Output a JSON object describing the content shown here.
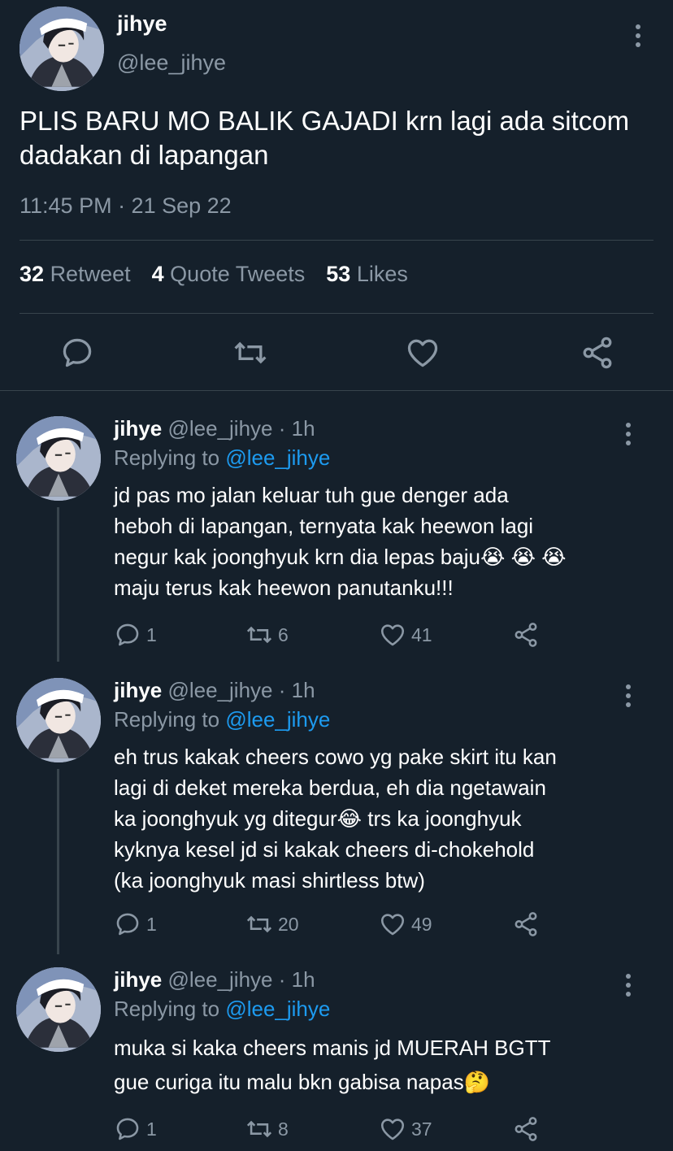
{
  "main": {
    "name": "jihye",
    "handle": "@lee_jihye",
    "text": "PLIS BARU MO BALIK GAJADI krn lagi ada sitcom dadakan di lapangan",
    "timestamp": "11:45 PM · 21 Sep 22",
    "stats": {
      "retweets_count": "32",
      "retweets_label": "Retweet",
      "quotes_count": "4",
      "quotes_label": "Quote Tweets",
      "likes_count": "53",
      "likes_label": "Likes"
    },
    "icons": [
      "reply-icon",
      "retweet-icon",
      "like-icon",
      "share-icon"
    ]
  },
  "replies": [
    {
      "name": "jihye",
      "handle": "@lee_jihye",
      "time": "· 1h",
      "replying_label": "Replying to",
      "replying_to": "@lee_jihye",
      "lines": [
        "jd pas mo jalan keluar tuh gue denger ada",
        "heboh di lapangan, ternyata kak heewon lagi",
        "negur kak joonghyuk krn dia lepas baju😭 😭 😭",
        "maju terus kak heewon panutanku!!!"
      ],
      "replies": "1",
      "retweets": "6",
      "likes": "41"
    },
    {
      "name": "jihye",
      "handle": "@lee_jihye",
      "time": "· 1h",
      "replying_label": "Replying to",
      "replying_to": "@lee_jihye",
      "lines": [
        "eh trus kakak cheers cowo yg pake skirt itu kan",
        "lagi di deket mereka berdua, eh dia ngetawain",
        "ka joonghyuk yg ditegur😂  trs ka joonghyuk",
        "kyknya kesel jd si kakak cheers di-chokehold",
        "(ka joonghyuk masi shirtless btw)"
      ],
      "replies": "1",
      "retweets": "20",
      "likes": "49"
    },
    {
      "name": "jihye",
      "handle": "@lee_jihye",
      "time": "· 1h",
      "replying_label": "Replying to",
      "replying_to": "@lee_jihye",
      "lines": [
        "muka si kaka cheers manis jd MUERAH BGTT",
        "gue curiga itu malu bkn gabisa napas🤔"
      ],
      "replies": "1",
      "retweets": "8",
      "likes": "37"
    }
  ],
  "colors": {
    "background": "#15202b",
    "text": "#ffffff",
    "muted": "#8b98a5",
    "link": "#1d9bf0",
    "divider": "#38444d"
  }
}
